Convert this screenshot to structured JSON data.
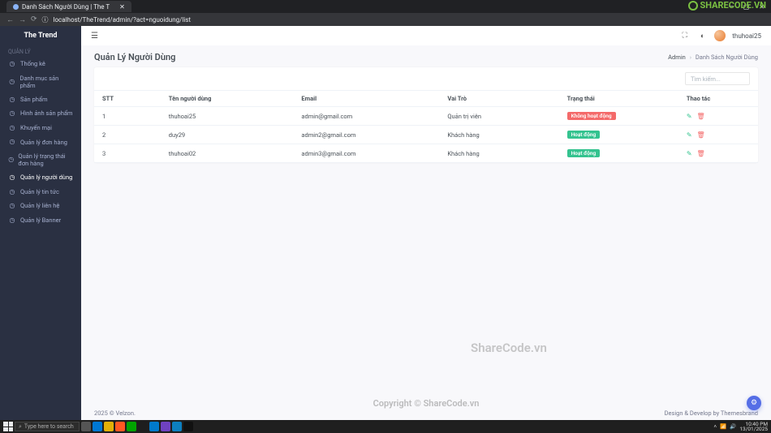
{
  "browser": {
    "tab_title": "Danh Sách Người Dùng | The T",
    "url": "localhost/TheTrend/admin/?act=nguoidung/list",
    "win_min": "—",
    "win_max": "▢",
    "win_close": "✕"
  },
  "brand": "The Trend",
  "sidebar": {
    "section_label": "QUẢN LÝ",
    "items": [
      {
        "label": "Thống kê",
        "icon": "◷"
      },
      {
        "label": "Danh mục sản phẩm",
        "icon": "◷"
      },
      {
        "label": "Sản phẩm",
        "icon": "◷"
      },
      {
        "label": "Hình ảnh sản phẩm",
        "icon": "◷"
      },
      {
        "label": "Khuyến mại",
        "icon": "◷"
      },
      {
        "label": "Quản lý đơn hàng",
        "icon": "◷"
      },
      {
        "label": "Quản lý trạng thái đơn hàng",
        "icon": "◷"
      },
      {
        "label": "Quản lý người dùng",
        "icon": "◷"
      },
      {
        "label": "Quản lý tin tức",
        "icon": "◷"
      },
      {
        "label": "Quản lý liên hệ",
        "icon": "◷"
      },
      {
        "label": "Quản lý Banner",
        "icon": "◷"
      }
    ]
  },
  "topbar": {
    "username": "thuhoai25"
  },
  "page": {
    "title": "Quản Lý Người Dùng",
    "breadcrumb_root": "Admin",
    "breadcrumb_current": "Danh Sách Người Dùng",
    "search_placeholder": "Tìm kiếm..."
  },
  "table": {
    "headers": {
      "stt": "STT",
      "name": "Tên người dùng",
      "email": "Email",
      "role": "Vai Trò",
      "status": "Trạng thái",
      "action": "Thao tác"
    },
    "rows": [
      {
        "stt": "1",
        "name": "thuhoai25",
        "email": "admin@gmail.com",
        "role": "Quản trị viên",
        "status_label": "Không hoạt động",
        "status_color": "red"
      },
      {
        "stt": "2",
        "name": "duy29",
        "email": "admin2@gmail.com",
        "role": "Khách hàng",
        "status_label": "Hoạt động",
        "status_color": "teal"
      },
      {
        "stt": "3",
        "name": "thuhoai02",
        "email": "admin3@gmail.com",
        "role": "Khách hàng",
        "status_label": "Hoạt động",
        "status_color": "teal"
      }
    ]
  },
  "footer": {
    "left": "2025 © Velzon.",
    "right": "Design & Develop by Themesbrand"
  },
  "watermarks": {
    "w1": "ShareCode.vn",
    "w2": "Copyright © ShareCode.vn",
    "logo": "SHARECODE.VN"
  },
  "taskbar": {
    "search_placeholder": "Type here to search",
    "time": "10:40 PM",
    "date": "13/01/2025"
  }
}
